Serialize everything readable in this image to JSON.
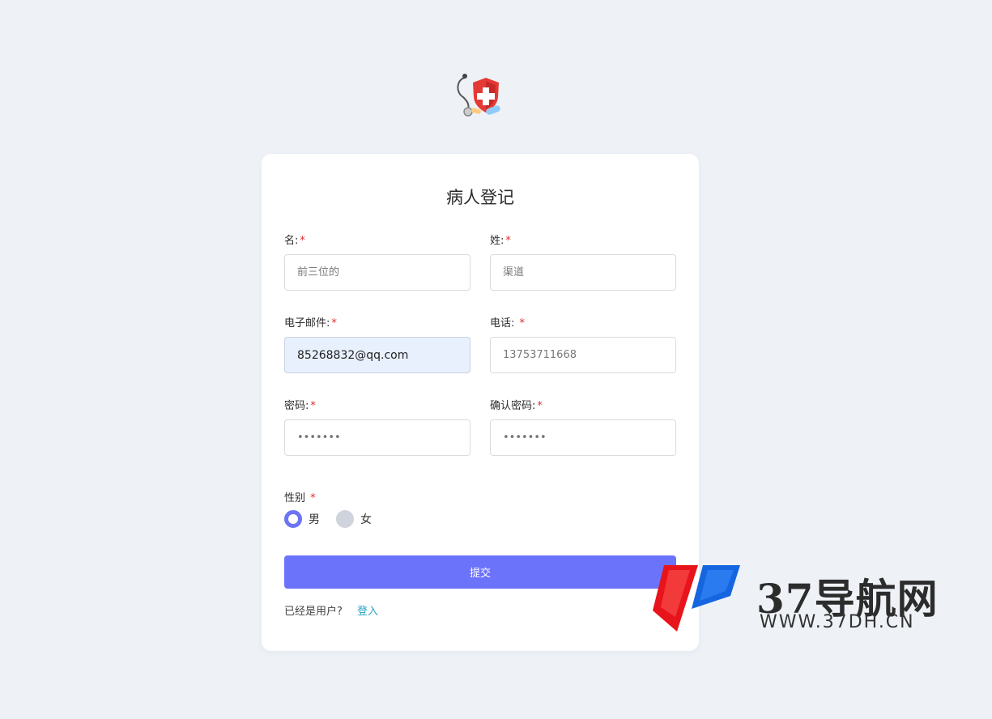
{
  "logo_icon": "medical-shield-stethoscope-icon",
  "form": {
    "title": "病人登记",
    "first_name": {
      "label": "名:",
      "required": "*",
      "placeholder": "前三位的"
    },
    "last_name": {
      "label": "姓:",
      "required": "*",
      "placeholder": "渠道"
    },
    "email": {
      "label": "电子邮件:",
      "required": "*",
      "value": "85268832@qq.com"
    },
    "phone": {
      "label": "电话: ",
      "required": "*",
      "placeholder": "13753711668"
    },
    "password": {
      "label": "密码:",
      "required": "*",
      "value": "1234567"
    },
    "confirm_password": {
      "label": "确认密码:",
      "required": "*",
      "value": "1234567"
    },
    "gender": {
      "label": "性别 ",
      "required": "*",
      "options": [
        {
          "label": "男",
          "checked": true
        },
        {
          "label": "女",
          "checked": false
        }
      ]
    },
    "submit_label": "提交",
    "footer_text": "已经是用户?",
    "login_link": "登入"
  },
  "colors": {
    "background": "#eef2f7",
    "accent": "#6c73fb",
    "required": "#e02d2d",
    "link": "#2aa3c4"
  },
  "watermark": {
    "brand": "37导航网",
    "url": "WWW.37DH.CN"
  }
}
